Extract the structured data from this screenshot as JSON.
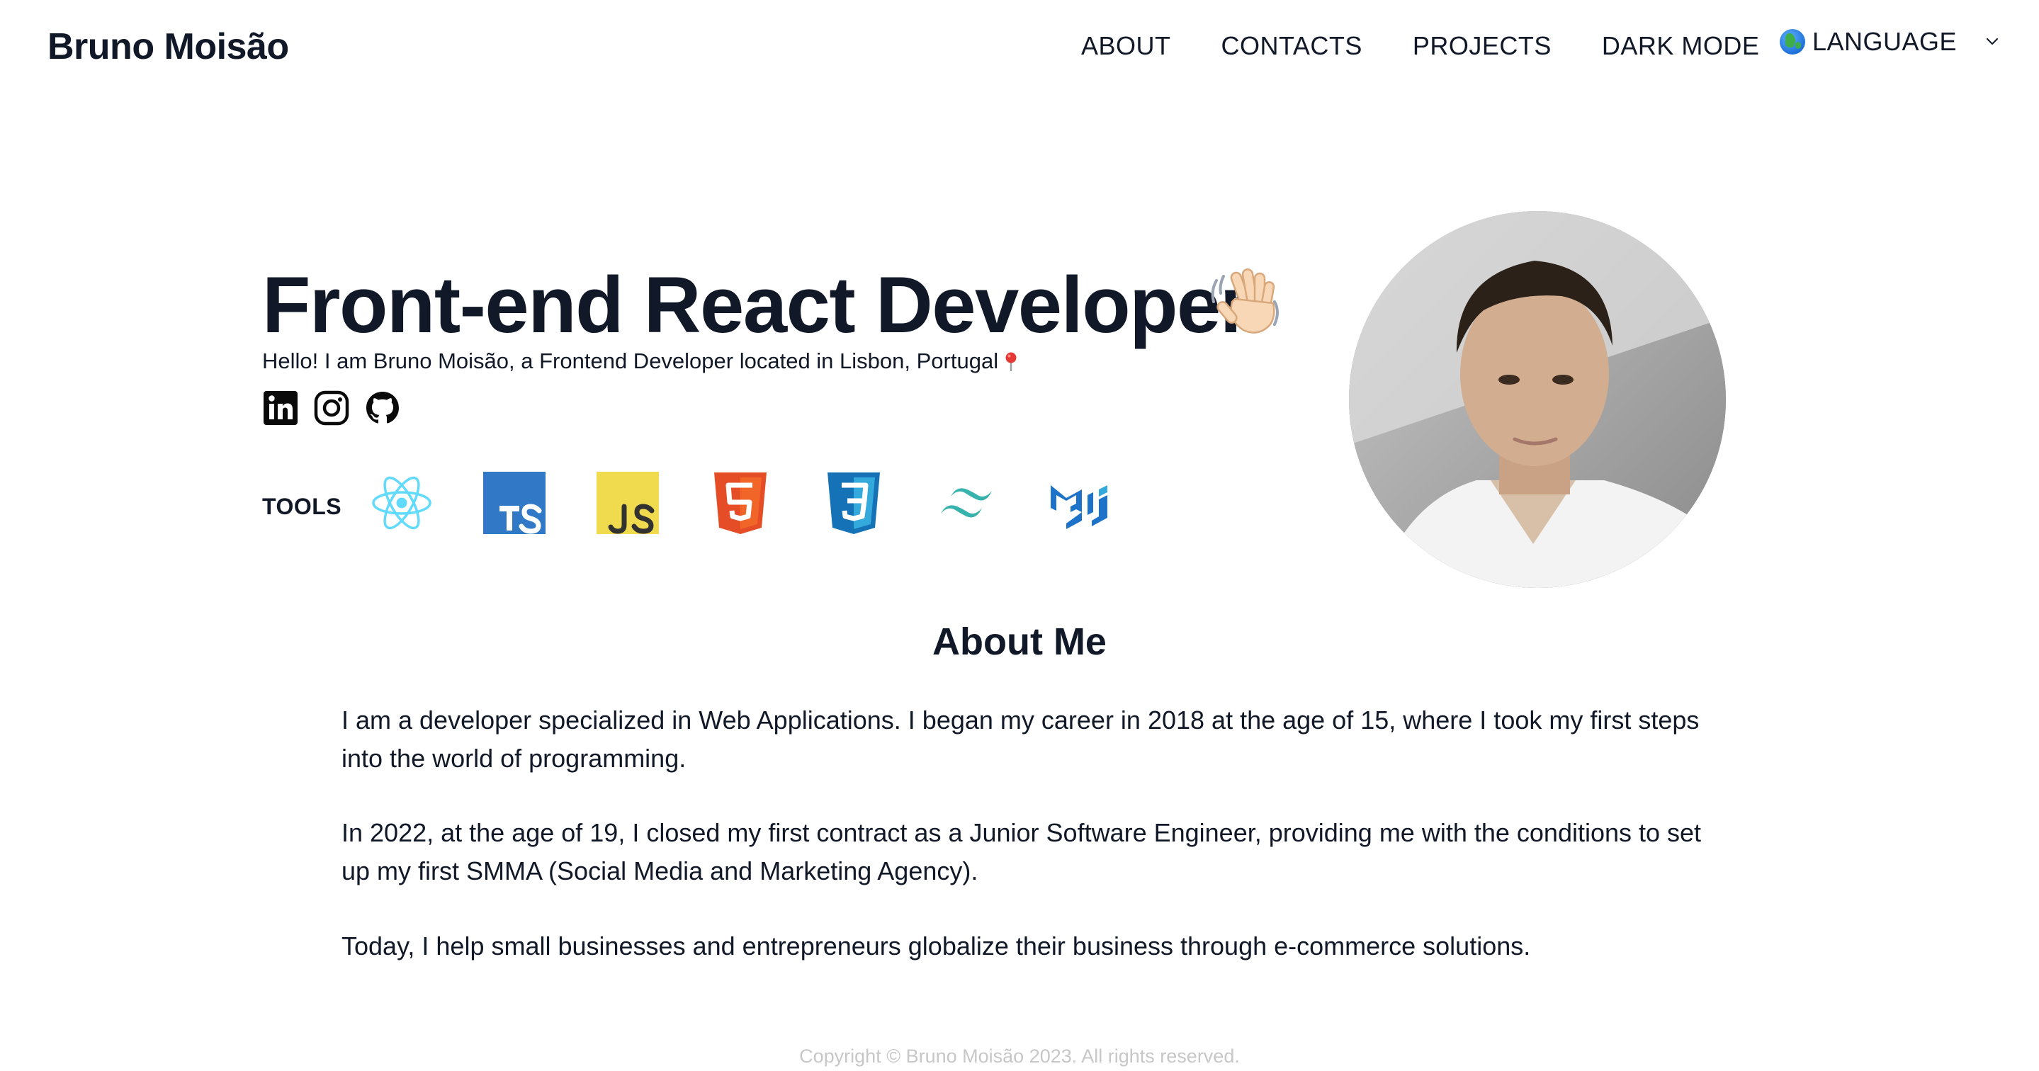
{
  "header": {
    "brand": "Bruno Moisão",
    "nav": [
      {
        "label": "ABOUT"
      },
      {
        "label": "CONTACTS"
      },
      {
        "label": "PROJECTS"
      },
      {
        "label": "DARK MODE"
      }
    ],
    "language_label": "LANGUAGE",
    "language_icon": "globe-icon"
  },
  "hero": {
    "title": "Front-end React Developer",
    "subtitle": "Hello! I am Bruno Moisão, a Frontend Developer located in Lisbon, Portugal",
    "social": [
      "linkedin-icon",
      "instagram-icon",
      "github-icon"
    ],
    "tools_label": "TOOLS",
    "tools": [
      "react-icon",
      "typescript-icon",
      "javascript-icon",
      "html5-icon",
      "css3-icon",
      "tailwind-icon",
      "material-ui-icon"
    ]
  },
  "about": {
    "title": "About Me",
    "paragraphs": [
      "I am a developer specialized in Web Applications. I began my career in 2018 at the age of 15, where I took my first steps into the world of programming.",
      "In 2022, at the age of 19, I closed my first contract as a Junior Software Engineer, providing me with the conditions to set up my first SMMA (Social Media and Marketing Agency).",
      "Today, I help small businesses and entrepreneurs globalize their business through e-commerce solutions."
    ]
  },
  "footer": {
    "copyright": "Copyright © Bruno Moisão 2023. All rights reserved."
  },
  "colors": {
    "text": "#111827",
    "footer_text": "#c7c7c7",
    "react": "#61dafb",
    "typescript": "#3178c6",
    "javascript": "#f0db4f",
    "html5": "#e44d26",
    "css3": "#2965f1",
    "tailwind": "#38b2ac",
    "material_ui": "#1d73c9"
  }
}
